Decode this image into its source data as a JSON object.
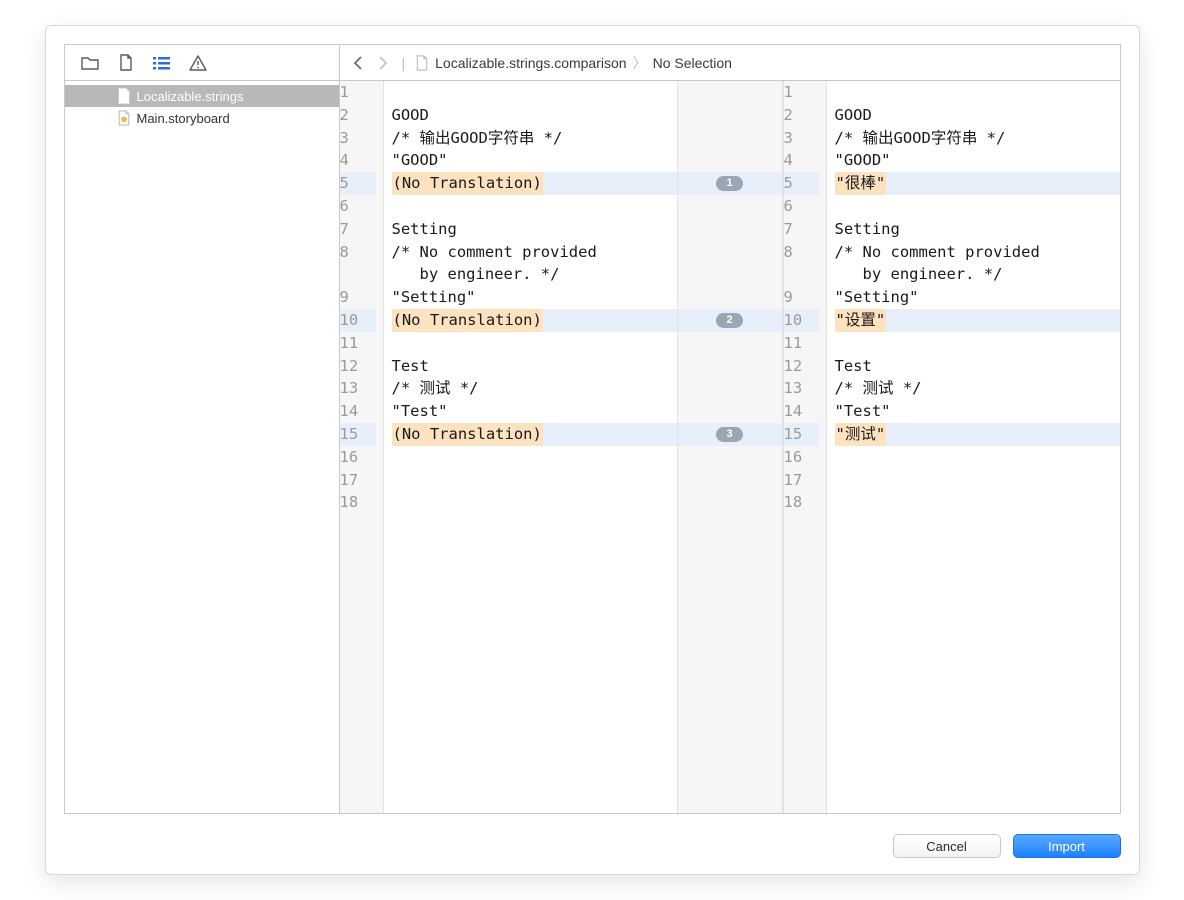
{
  "sidebar": {
    "items": [
      {
        "label": "Localizable.strings",
        "selected": true
      },
      {
        "label": "Main.storyboard",
        "selected": false
      }
    ]
  },
  "breadcrumb": {
    "file": "Localizable.strings.comparison",
    "selection": "No Selection"
  },
  "diff": {
    "left": {
      "1": "",
      "2": "GOOD",
      "3": "/* 输出GOOD字符串 */",
      "4": "\"GOOD\"",
      "5": "(No Translation)",
      "6": "",
      "7": "Setting",
      "8a": "/* No comment provided",
      "8b": "   by engineer. */",
      "9": "\"Setting\"",
      "10": "(No Translation)",
      "11": "",
      "12": "Test",
      "13": "/* 测试 */",
      "14": "\"Test\"",
      "15": "(No Translation)",
      "16": "",
      "17": "",
      "18": ""
    },
    "right": {
      "1": "",
      "2": "GOOD",
      "3": "/* 输出GOOD字符串 */",
      "4": "\"GOOD\"",
      "5": "\"很棒\"",
      "6": "",
      "7": "Setting",
      "8a": "/* No comment provided",
      "8b": "   by engineer. */",
      "9": "\"Setting\"",
      "10": "\"设置\"",
      "11": "",
      "12": "Test",
      "13": "/* 测试 */",
      "14": "\"Test\"",
      "15": "\"测试\"",
      "16": "",
      "17": "",
      "18": ""
    },
    "badges": {
      "b1": "1",
      "b2": "2",
      "b3": "3"
    },
    "ln": {
      "1": "1",
      "2": "2",
      "3": "3",
      "4": "4",
      "5": "5",
      "6": "6",
      "7": "7",
      "8": "8",
      "9": "9",
      "10": "10",
      "11": "11",
      "12": "12",
      "13": "13",
      "14": "14",
      "15": "15",
      "16": "16",
      "17": "17",
      "18": "18"
    }
  },
  "buttons": {
    "cancel": "Cancel",
    "import": "Import"
  }
}
